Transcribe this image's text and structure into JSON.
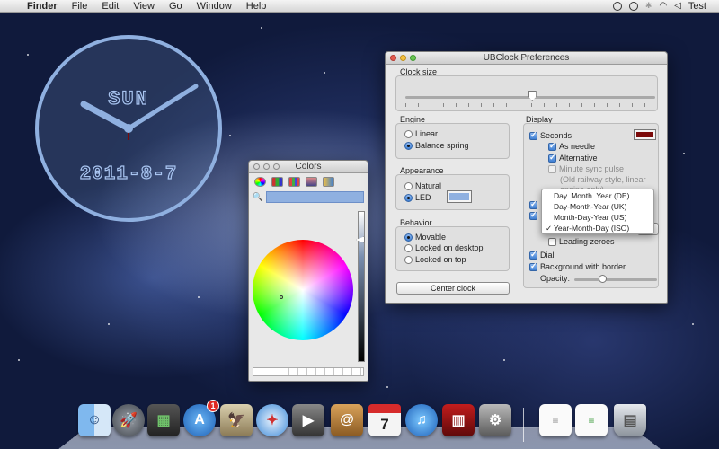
{
  "menubar": {
    "apple_glyph": "",
    "app_name": "Finder",
    "menus": [
      "File",
      "Edit",
      "View",
      "Go",
      "Window",
      "Help"
    ],
    "user": "Test"
  },
  "clock_widget": {
    "day": "SUN",
    "date": "2011-8-7"
  },
  "colors_panel": {
    "title": "Colors",
    "search_glyph": "🔍",
    "selected_color": "#8fb0e0"
  },
  "prefs": {
    "title": "UBClock Preferences",
    "clock_size": {
      "label": "Clock size",
      "value_fraction": 0.51
    },
    "engine": {
      "label": "Engine",
      "options": [
        "Linear",
        "Balance spring"
      ],
      "selected": "Balance spring"
    },
    "appearance": {
      "label": "Appearance",
      "options": [
        "Natural",
        "LED"
      ],
      "selected": "LED",
      "led_color": "#8fb0e0"
    },
    "behavior": {
      "label": "Behavior",
      "options": [
        "Movable",
        "Locked on desktop",
        "Locked on top"
      ],
      "selected": "Movable"
    },
    "center_button": "Center clock",
    "display": {
      "label": "Display",
      "seconds": "Seconds",
      "seconds_color": "#7b0a0a",
      "as_needle": "As needle",
      "alternative": "Alternative",
      "minute_sync": "Minute sync pulse",
      "minute_sync_note_1": "(Old railway style, linear",
      "minute_sync_note_2": "engine only)",
      "leading_zeroes": "Leading zeroes",
      "dial": "Dial",
      "background_border": "Background with border",
      "opacity_label": "Opacity:",
      "opacity_fraction": 0.35
    },
    "date_format_menu": {
      "items": [
        "Day. Month. Year (DE)",
        "Day-Month-Year (UK)",
        "Month-Day-Year (US)",
        "Year-Month-Day (ISO)"
      ],
      "selected": "Year-Month-Day (ISO)",
      "check_glyph": "✓"
    }
  },
  "dock": {
    "items": [
      "Finder",
      "Launchpad",
      "Photo Browser",
      "App Store",
      "Preview",
      "Safari",
      "FaceTime",
      "Address Book",
      "Calendar",
      "iTunes",
      "Photo Booth",
      "System Preferences",
      "Document",
      "Document",
      "Trash"
    ],
    "app_store_badge": "1",
    "calendar_day": "7"
  }
}
